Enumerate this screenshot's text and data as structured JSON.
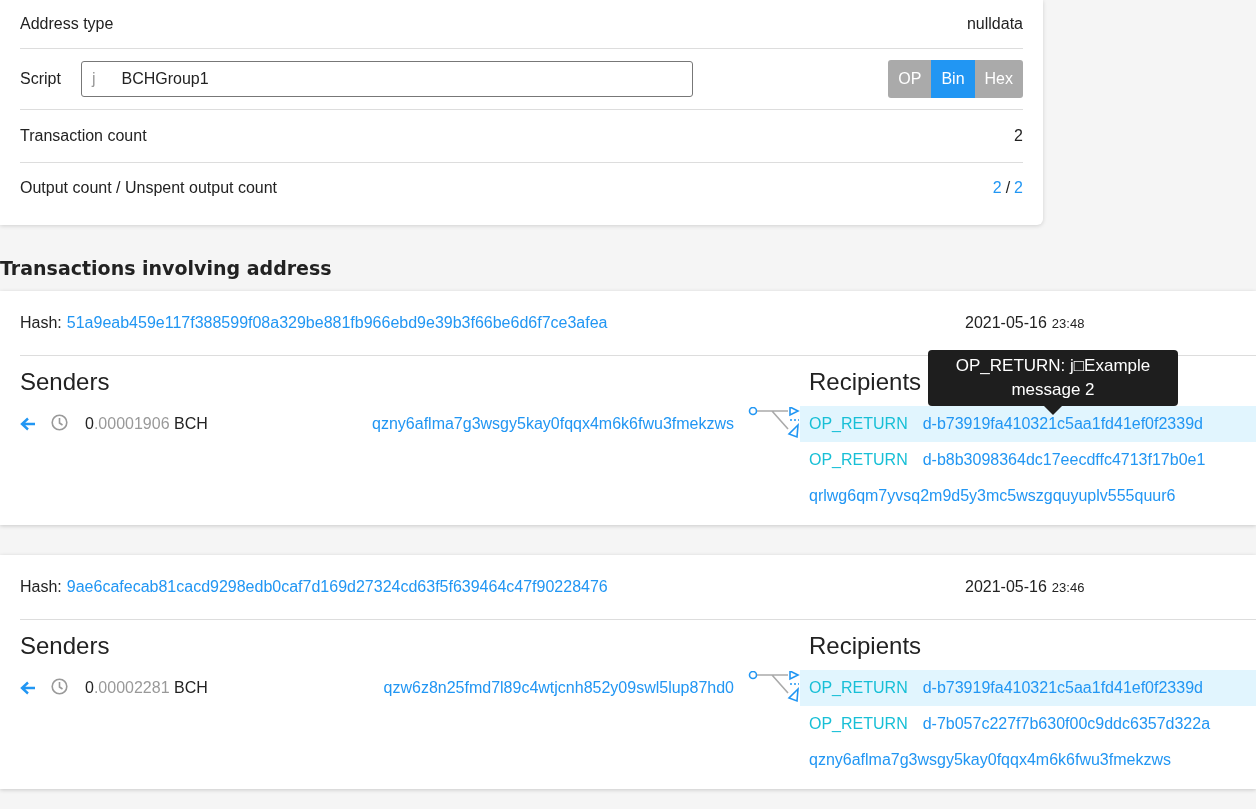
{
  "details": {
    "address_type": {
      "label": "Address type",
      "value": "nulldata"
    },
    "script": {
      "label": "Script",
      "prefix": "j",
      "value": "BCHGroup1",
      "formats": [
        {
          "label": "OP",
          "selected": false
        },
        {
          "label": "Bin",
          "selected": true
        },
        {
          "label": "Hex",
          "selected": false
        }
      ]
    },
    "transaction_count": {
      "label": "Transaction count",
      "value": "2"
    },
    "output_count": {
      "label": "Output count / Unspent output count",
      "outputs": "2",
      "separator": "/",
      "unspent": "2"
    }
  },
  "section_title": "Transactions involving address",
  "transactions": [
    {
      "hash_label": "Hash:",
      "hash": "51a9eab459e117f388599f08a329be881fb966ebd9e39b3f66be6d6f7ce3afea",
      "date": "2021-05-16",
      "time": "23:48",
      "senders_title": "Senders",
      "senders": [
        {
          "amount_int": "0",
          "amount_frac": ".00001906",
          "unit": "BCH",
          "address": "qzny6aflma7g3wsgy5kay0fqqx4m6k6fwu3fmekzws"
        }
      ],
      "recipients_title": "Recipients",
      "recipients": [
        {
          "kind": "op_return",
          "type_label": "OP_RETURN",
          "address": "d-b73919fa410321c5aa1fd41ef0f2339d",
          "highlighted": true
        },
        {
          "kind": "op_return",
          "type_label": "OP_RETURN",
          "address": "d-b8b3098364dc17eecdffc4713f17b0e1",
          "highlighted": false
        },
        {
          "kind": "address",
          "address": "qrlwg6qm7yvsq2m9d5y3mc5wszgquyuplv555quur6",
          "highlighted": false
        }
      ],
      "tooltip": {
        "text": "OP_RETURN: j□Example message 2"
      }
    },
    {
      "hash_label": "Hash:",
      "hash": "9ae6cafecab81cacd9298edb0caf7d169d27324cd63f5f639464c47f90228476",
      "date": "2021-05-16",
      "time": "23:46",
      "senders_title": "Senders",
      "senders": [
        {
          "amount_int": "0",
          "amount_frac": ".00002281",
          "unit": "BCH",
          "address": "qzw6z8n25fmd7l89c4wtjcnh852y09swl5lup87hd0"
        }
      ],
      "recipients_title": "Recipients",
      "recipients": [
        {
          "kind": "op_return",
          "type_label": "OP_RETURN",
          "address": "d-b73919fa410321c5aa1fd41ef0f2339d",
          "highlighted": true
        },
        {
          "kind": "op_return",
          "type_label": "OP_RETURN",
          "address": "d-7b057c227f7b630f00c9ddc6357d322a",
          "highlighted": false
        },
        {
          "kind": "address",
          "address": "qzny6aflma7g3wsgy5kay0fqqx4m6k6fwu3fmekzws",
          "highlighted": false
        }
      ]
    }
  ]
}
